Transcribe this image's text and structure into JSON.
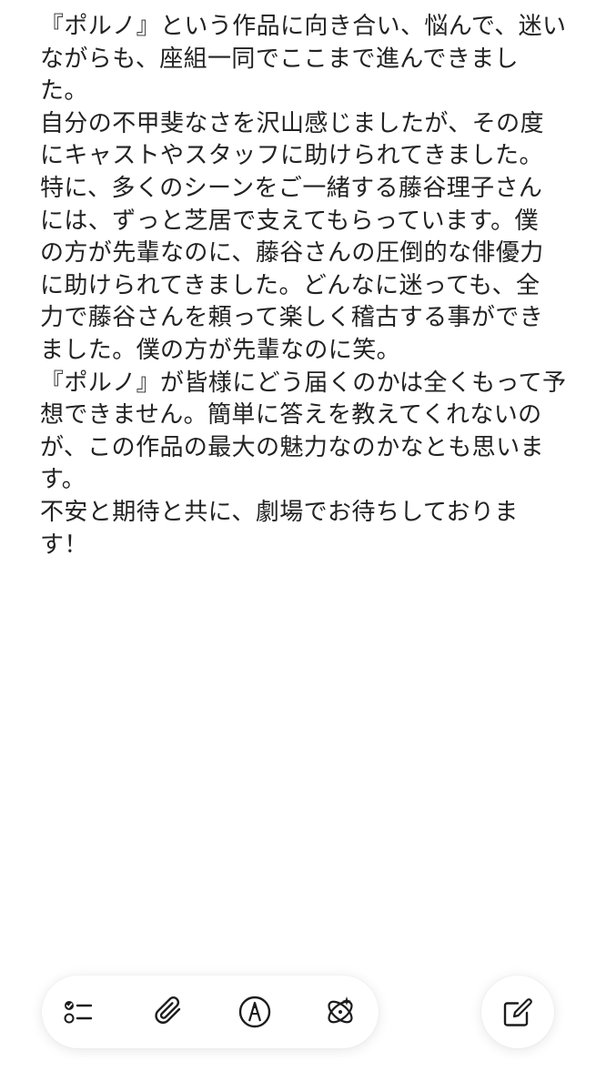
{
  "note": {
    "lines": [
      "『ポルノ』という作品に向き合い、悩んで、迷い",
      "ながらも、座組一同でここまで進んできまし",
      "た。",
      "自分の不甲斐なさを沢山感じましたが、その度",
      "にキャストやスタッフに助けられてきました。",
      "特に、多くのシーンをご一緒する藤谷理子さん",
      "には、ずっと芝居で支えてもらっています。僕",
      "の方が先輩なのに、藤谷さんの圧倒的な俳優力",
      "に助けられてきました。どんなに迷っても、全",
      "力で藤谷さんを頼って楽しく稽古する事ができ",
      "ました。僕の方が先輩なのに笑。",
      "『ポルノ』が皆様にどう届くのかは全くもって予",
      "想できません。簡単に答えを教えてくれないの",
      "が、この作品の最大の魅力なのかなとも思いま",
      "す。",
      "不安と期待と共に、劇場でお待ちしておりま",
      "す！"
    ]
  },
  "toolbar": {
    "icons": [
      "checklist-icon",
      "paperclip-icon",
      "markup-pen-icon",
      "apple-intelligence-icon"
    ],
    "compose_icon": "compose-icon"
  }
}
